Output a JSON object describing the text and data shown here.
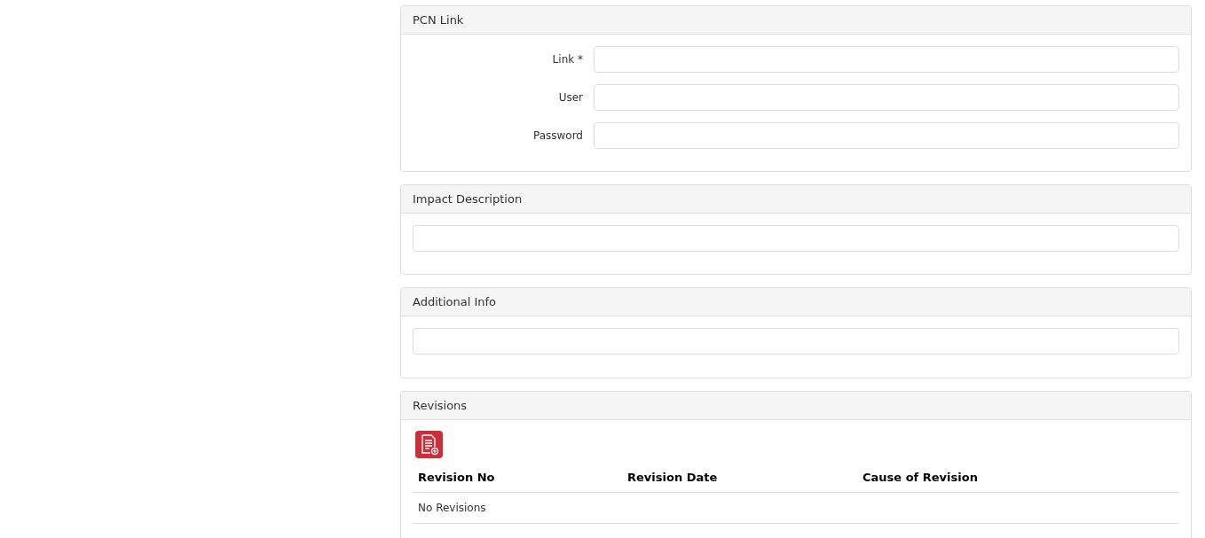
{
  "pcn_link": {
    "title": "PCN Link",
    "fields": [
      {
        "label": "Link *"
      },
      {
        "label": "User"
      },
      {
        "label": "Password"
      }
    ]
  },
  "impact_description": {
    "title": "Impact Description"
  },
  "additional_info": {
    "title": "Additional Info"
  },
  "revisions": {
    "title": "Revisions",
    "table": {
      "columns": [
        "Revision No",
        "Revision Date",
        "Cause of Revision"
      ],
      "empty_message": "No Revisions"
    }
  }
}
